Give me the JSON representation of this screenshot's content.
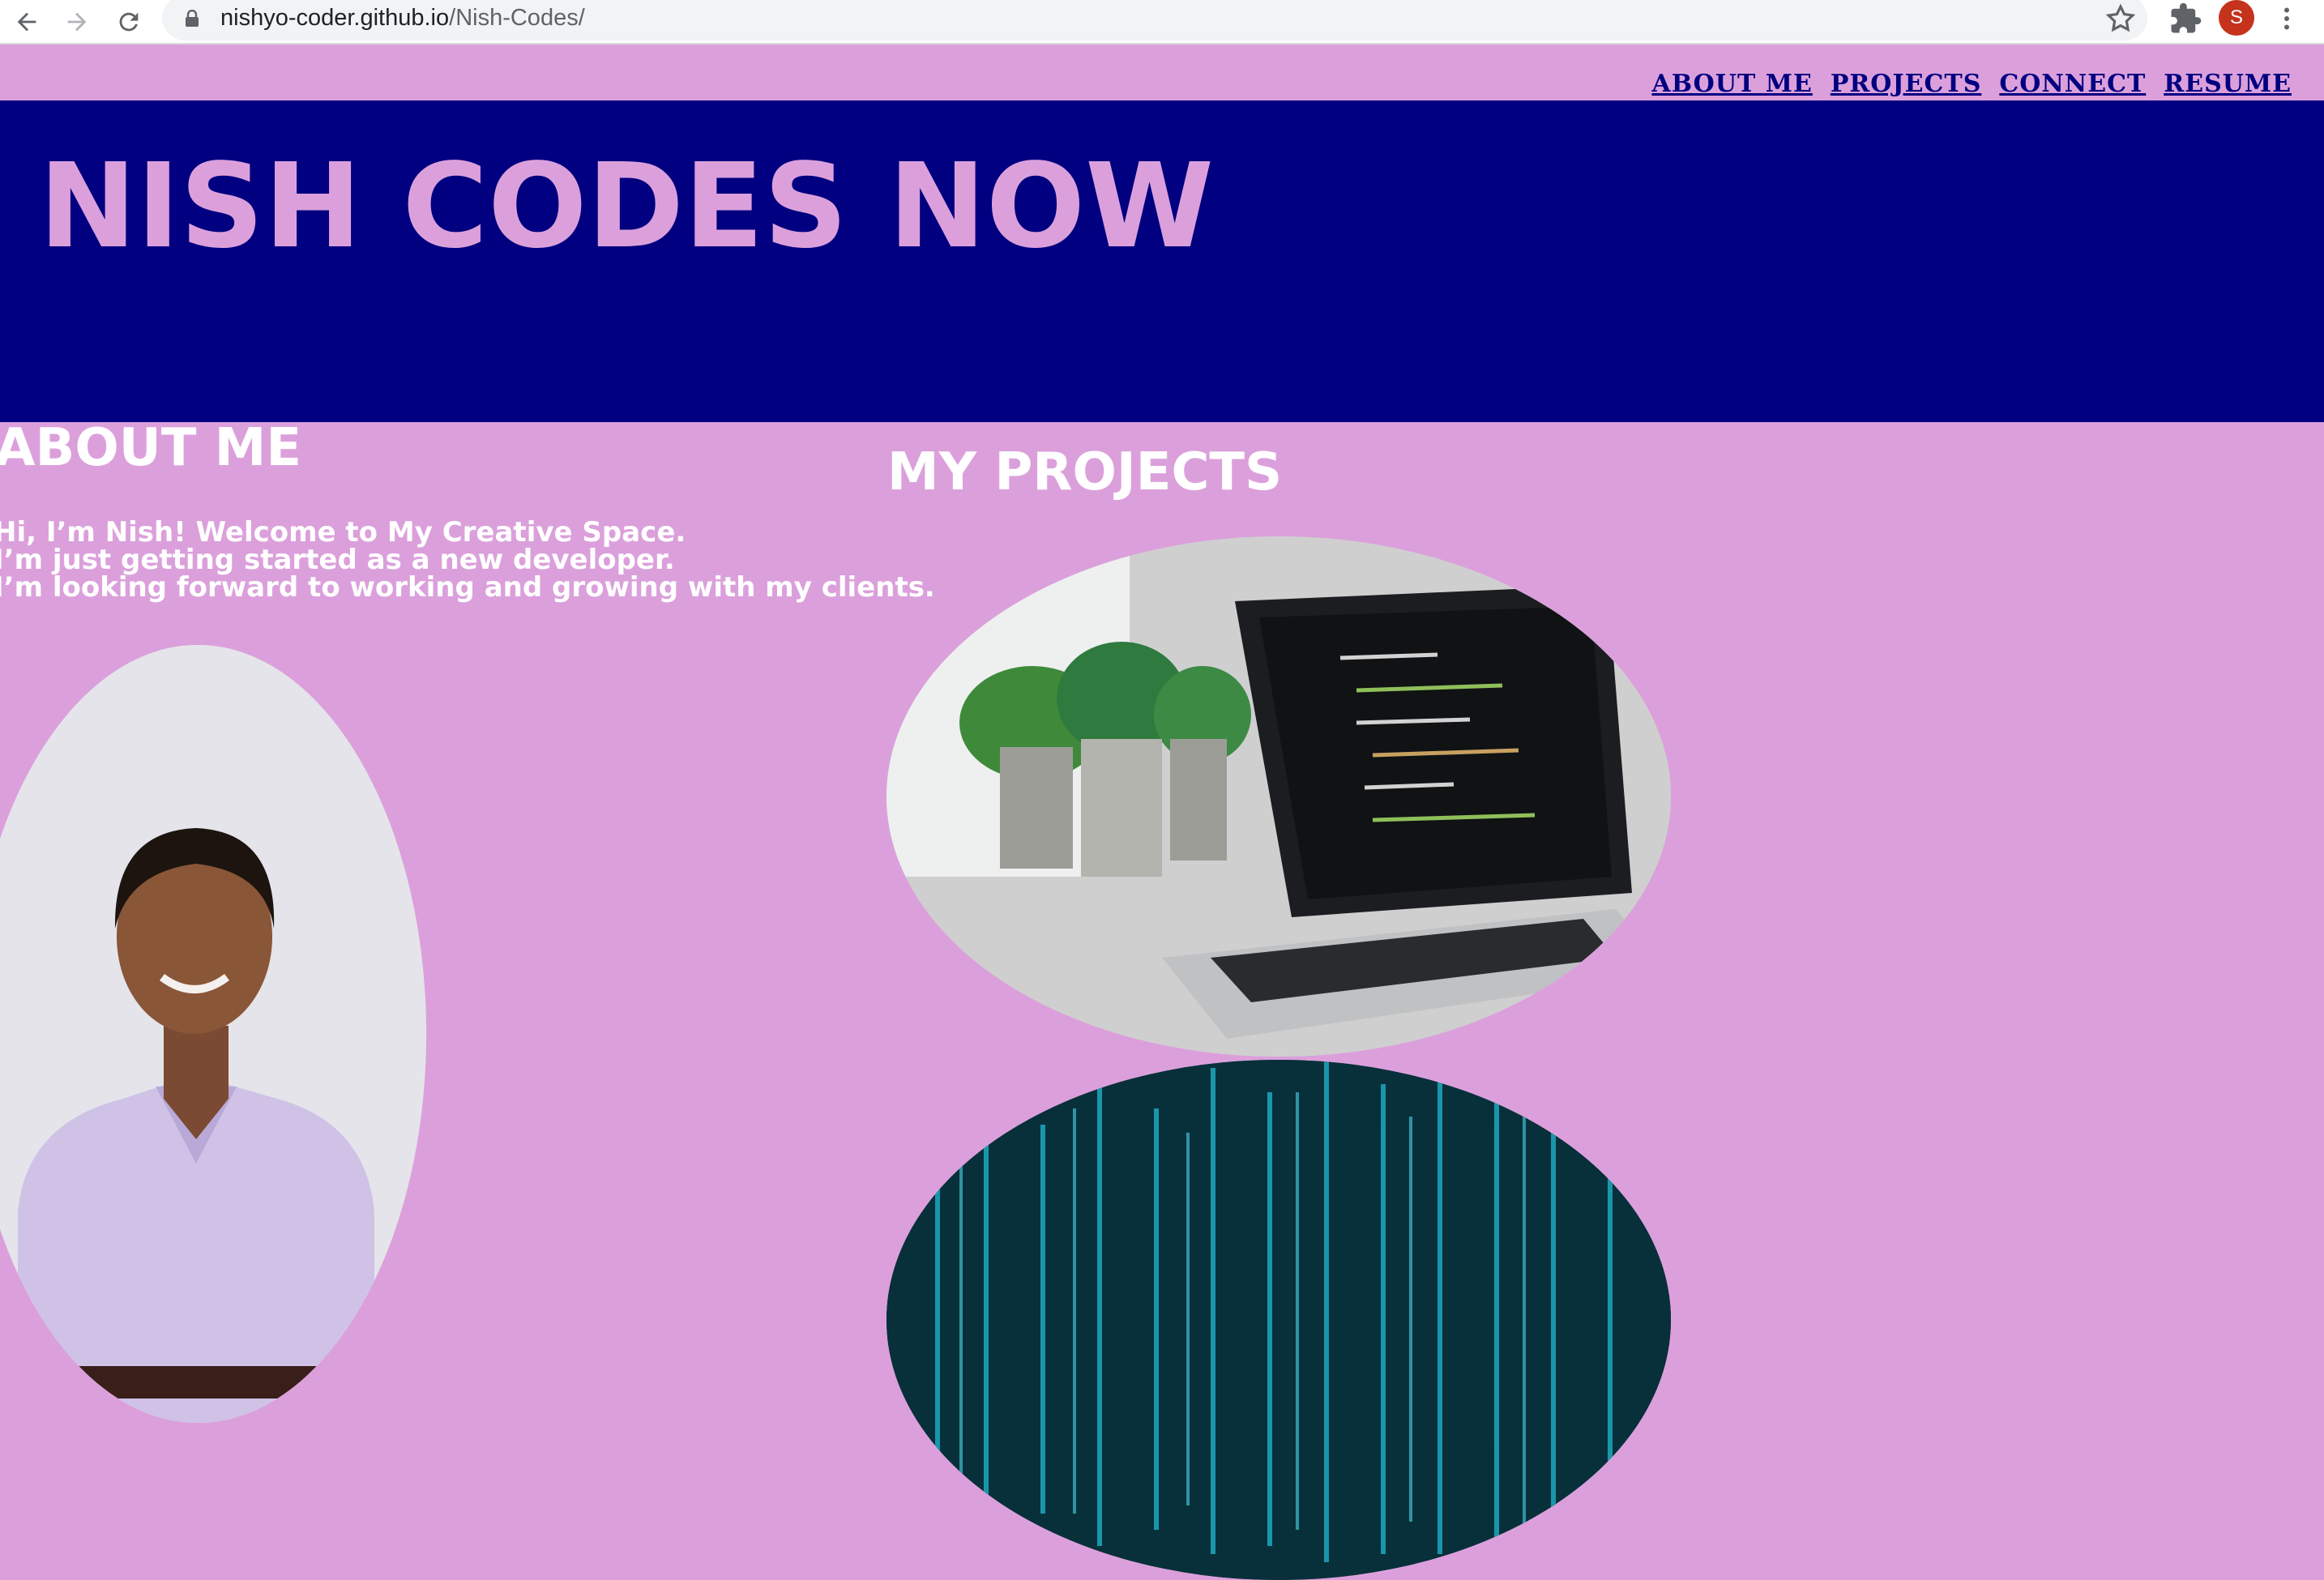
{
  "browser": {
    "url_host": "nishyo-coder.github.io",
    "url_path": "/Nish-Codes/",
    "profile_initial": "S"
  },
  "nav": {
    "items": [
      "ABOUT ME",
      "PROJECTS",
      "CONNECT",
      "RESUME"
    ]
  },
  "header": {
    "title": "NISH CODES NOW"
  },
  "about": {
    "heading": "ABOUT ME",
    "lines": [
      "Hi, I’m Nish! Welcome to My Creative Space.",
      "I’m just getting started as a new developer.",
      "I’m looking forward to working and growing with my clients."
    ]
  },
  "projects": {
    "heading": "MY PROJECTS"
  },
  "colors": {
    "background": "#DBA0DB",
    "header_bg": "#000080",
    "title": "#DBA0DB",
    "nav_link": "#000080"
  }
}
